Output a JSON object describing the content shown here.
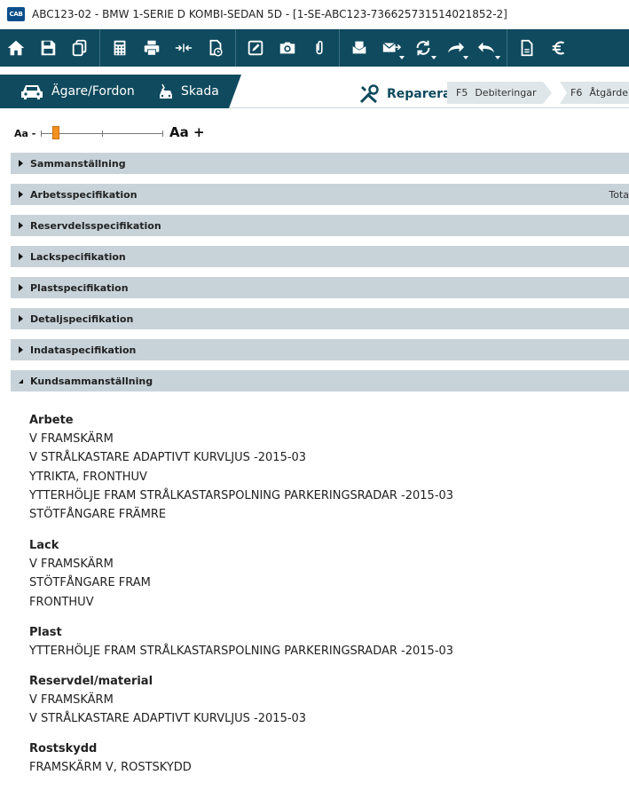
{
  "window": {
    "logo": "CAB",
    "title": "ABC123-02 - BMW 1-SERIE D KOMBI-SEDAN 5D - [1-SE-ABC123-736625731514021852-2]"
  },
  "nav": {
    "owner_vehicle": "Ägare/Fordon",
    "damage": "Skada",
    "repair": "Reparera",
    "steps": [
      {
        "key": "F5",
        "label": "Debiteringar"
      },
      {
        "key": "F6",
        "label": "Åtgärder"
      }
    ]
  },
  "zoom": {
    "smaller": "Aa -",
    "larger": "Aa +",
    "level": 0.12
  },
  "sections": [
    {
      "label": "Sammanställning",
      "right": ""
    },
    {
      "label": "Arbetsspecifikation",
      "right": "Tota"
    },
    {
      "label": "Reservdelsspecifikation",
      "right": ""
    },
    {
      "label": "Lackspecifikation",
      "right": ""
    },
    {
      "label": "Plastspecifikation",
      "right": ""
    },
    {
      "label": "Detaljspecifikation",
      "right": ""
    },
    {
      "label": "Indataspecifikation",
      "right": ""
    },
    {
      "label": "Kundsammanställning",
      "right": ""
    }
  ],
  "summary": {
    "groups": [
      {
        "heading": "Arbete",
        "items": [
          "V FRAMSKÄRM",
          "V STRÅLKASTARE ADAPTIVT KURVLJUS -2015-03",
          "YTRIKTA, FRONTHUV",
          "YTTERHÖLJE FRAM STRÅLKASTARSPOLNING PARKERINGSRADAR -2015-03",
          "STÖTFÅNGARE FRÄMRE"
        ]
      },
      {
        "heading": "Lack",
        "items": [
          "V FRAMSKÄRM",
          "STÖTFÅNGARE FRAM",
          "FRONTHUV"
        ]
      },
      {
        "heading": "Plast",
        "items": [
          "YTTERHÖLJE FRAM STRÅLKASTARSPOLNING PARKERINGSRADAR -2015-03"
        ]
      },
      {
        "heading": "Reservdel/material",
        "items": [
          "V FRAMSKÄRM",
          "V STRÅLKASTARE ADAPTIVT KURVLJUS -2015-03"
        ]
      },
      {
        "heading": "Rostskydd",
        "items": [
          "FRAMSKÄRM V, ROSTSKYDD"
        ]
      }
    ]
  },
  "colors": {
    "toolbar": "#0f4a5e",
    "section": "#c8d3d9",
    "slider_thumb": "#f39221"
  }
}
